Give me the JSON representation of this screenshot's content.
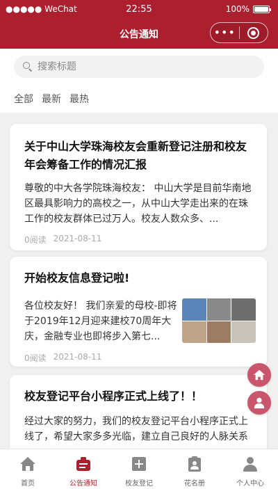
{
  "status_bar": {
    "carrier": "●●●●● WeChat",
    "time": "22:55",
    "battery": "100%",
    "battery_level": 1.0
  },
  "nav": {
    "title": "公告通知",
    "more": "•••"
  },
  "search": {
    "placeholder": "搜索标题",
    "value": ""
  },
  "tabs": [
    {
      "label": "全部"
    },
    {
      "label": "最新"
    },
    {
      "label": "最热"
    }
  ],
  "articles": [
    {
      "title": "关于中山大学珠海校友会重新登记注册和校友年会筹备工作的情况汇报",
      "body": "尊敬的中大各学院珠海校友： 中山大学是目前华南地区最具影响力的高校之一，从中山大学走出来的在珠工作的校友群体已过万人。校友人数众多、...",
      "views": "0阅读",
      "date": "2021-08-11"
    },
    {
      "title": "开始校友信息登记啦!",
      "body": "各位校友好！ 我们亲爱的母校-即将于2019年12月迎来建校70周年大庆，金融专业也即将步入第七...",
      "views": "0阅读",
      "date": "2021-08-11",
      "has_image": true
    },
    {
      "title": "校友登记平台小程序正式上线了！！",
      "body": "经过大家的努力，我们的校友登记平台小程序正式上线了，希望大家多多光临，建立自己良好的人脉关系",
      "views": "",
      "date": ""
    }
  ],
  "fab": {
    "home_icon": "home-icon",
    "user_icon": "user-icon"
  },
  "tab_bar": [
    {
      "label": "首页",
      "icon": "home-icon"
    },
    {
      "label": "公告通知",
      "icon": "announcement-icon",
      "active": true
    },
    {
      "label": "校友登记",
      "icon": "add-square-icon"
    },
    {
      "label": "花名册",
      "icon": "roster-icon"
    },
    {
      "label": "个人中心",
      "icon": "person-icon"
    }
  ],
  "colors": {
    "brand": "#ac1f2e",
    "fab": "#c9566c",
    "background": "#f0f0f0"
  }
}
